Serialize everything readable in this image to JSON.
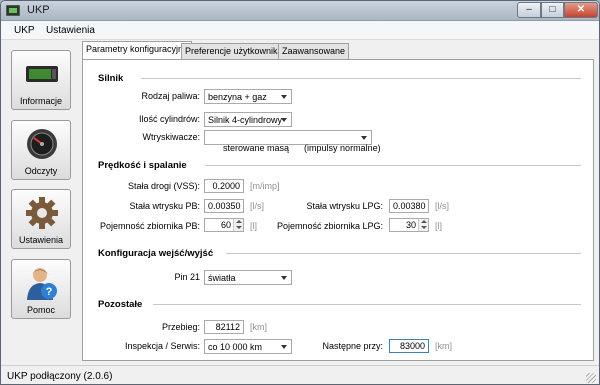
{
  "window": {
    "title": "UKP"
  },
  "menu": {
    "items": [
      "UKP",
      "Ustawienia"
    ]
  },
  "sidebar": {
    "items": [
      {
        "label": "Informacje",
        "icon": "device-icon"
      },
      {
        "label": "Odczyty",
        "icon": "gauge-icon"
      },
      {
        "label": "Ustawienia",
        "icon": "gear-icon"
      },
      {
        "label": "Pomoc",
        "icon": "help-person-icon"
      }
    ]
  },
  "tabs": [
    {
      "label": "Parametry konfiguracyjne",
      "active": true
    },
    {
      "label": "Preferencje użytkownika",
      "active": false
    },
    {
      "label": "Zaawansowane",
      "active": false
    }
  ],
  "silnik": {
    "title": "Silnik",
    "fuel_label": "Rodzaj paliwa:",
    "fuel_value": "benzyna + gaz",
    "cyl_label": "Ilość cylindrów:",
    "cyl_value": "Silnik 4-cylindrowy",
    "inj_label": "Wtryskiwacze:",
    "inj_value": "sterowane masą      (impulsy normalne)"
  },
  "predkosc": {
    "title": "Prędkość i spalanie",
    "vss_label": "Stała drogi (VSS):",
    "vss_value": "0.2000",
    "vss_unit": "[m/imp]",
    "pb_label": "Stała wtrysku PB:",
    "pb_value": "0.00350",
    "pb_unit": "[l/s]",
    "lpg_label": "Stała wtrysku LPG:",
    "lpg_value": "0.00380",
    "lpg_unit": "[l/s]",
    "tank_pb_label": "Pojemność zbiornika PB:",
    "tank_pb_value": "60",
    "tank_pb_unit": "[l]",
    "tank_lpg_label": "Pojemność zbiornika LPG:",
    "tank_lpg_value": "30",
    "tank_lpg_unit": "[l]"
  },
  "konfig": {
    "title": "Konfiguracja wejść/wyjść",
    "pin_label": "Pin 21",
    "pin_value": "światła"
  },
  "pozostale": {
    "title": "Pozostałe",
    "przebieg_label": "Przebieg:",
    "przebieg_value": "82112",
    "przebieg_unit": "[km]",
    "insp_label": "Inspekcja / Serwis:",
    "insp_value": "co 10 000 km",
    "next_label": "Następne przy:",
    "next_value": "83000",
    "next_unit": "[km]"
  },
  "status": {
    "text": "UKP podłączony (2.0.6)"
  }
}
